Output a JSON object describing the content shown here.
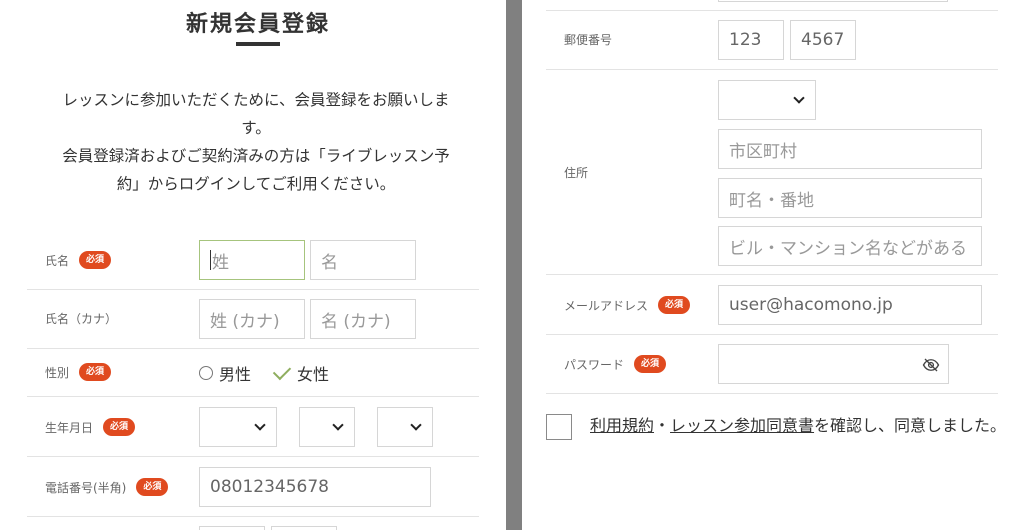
{
  "form": {
    "title": "新規会員登録",
    "intro_lines": [
      "レッスンに参加いただくために、会員登録をお願いしま",
      "す。",
      "会員登録済およびご契約済みの方は「ライブレッスン予",
      "約」からログインしてご利用ください。"
    ],
    "required_badge": "必須"
  },
  "fields": {
    "name": {
      "label": "氏名",
      "last_placeholder": "姓",
      "first_placeholder": "名"
    },
    "kana": {
      "label": "氏名（カナ）",
      "last_placeholder": "姓 (カナ)",
      "first_placeholder": "名 (カナ)"
    },
    "gender": {
      "label": "性別",
      "options": [
        "男性",
        "女性"
      ],
      "selected": "女性"
    },
    "birthday": {
      "label": "生年月日"
    },
    "phone": {
      "label": "電話番号(半角)",
      "value": "08012345678"
    },
    "postal": {
      "label": "郵便番号",
      "part1": "123",
      "part2": "4567"
    },
    "address": {
      "label": "住所",
      "city_placeholder": "市区町村",
      "street_placeholder": "町名・番地",
      "building_placeholder": "ビル・マンション名などがある"
    },
    "email": {
      "label": "メールアドレス",
      "value": "user@hacomono.jp"
    },
    "password": {
      "label": "パスワード"
    }
  },
  "agreement": {
    "terms_link": "利用規約",
    "separator": "・",
    "consent_link": "レッスン参加同意書",
    "text": "を確認し、同意しました。"
  },
  "colors": {
    "required_badge": "#e04a1f",
    "focus_border": "#a6c47d",
    "check_mark": "#8fae5f",
    "divider": "#808080"
  }
}
